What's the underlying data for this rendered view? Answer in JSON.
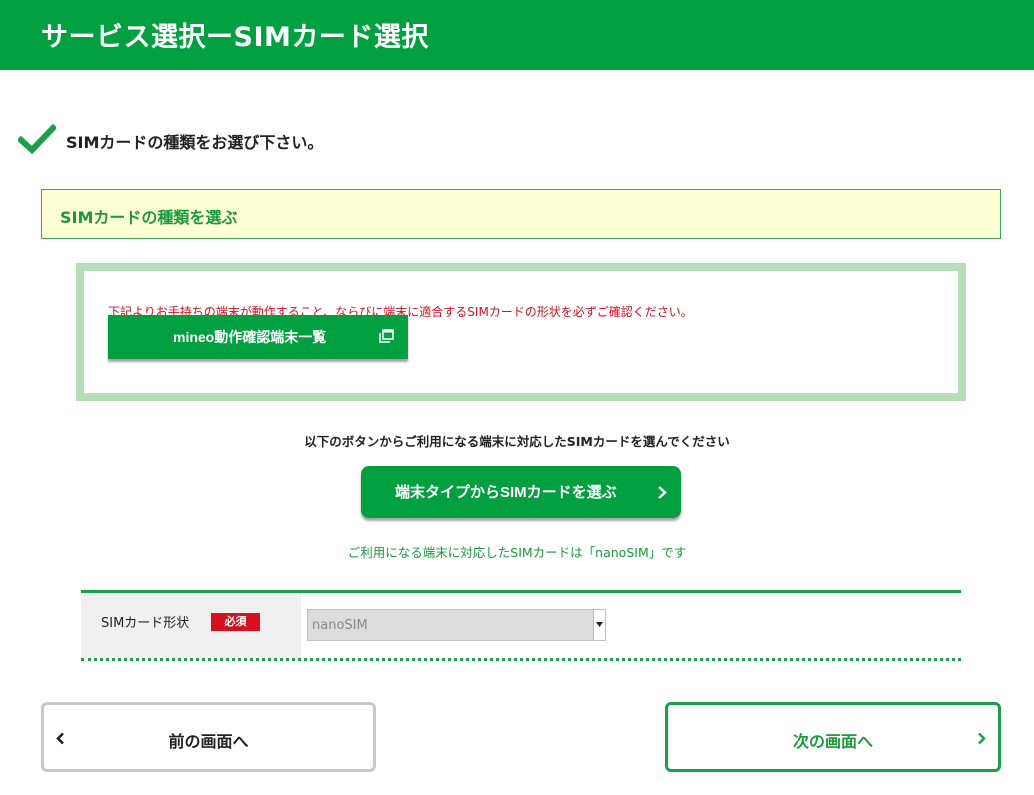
{
  "header": {
    "title": "サービス選択ーSIMカード選択"
  },
  "instruction": {
    "text": "SIMカードの種類をお選び下さい。"
  },
  "section": {
    "title": "SIMカードの種類を選ぶ"
  },
  "notice": {
    "text": "下記よりお手持ちの端末が動作すること、ならびに端末に適合するSIMカードの形状を必ずご確認ください。",
    "device_list_button": "mineo動作確認端末一覧"
  },
  "selection": {
    "guidance": "以下のボタンからご利用になる端末に対応したSIMカードを選んでください",
    "device_type_button": "端末タイプからSIMカードを選ぶ",
    "compat_note": "ご利用になる端末に対応したSIMカードは「nanoSIM」です"
  },
  "form": {
    "sim_shape_label": "SIMカード形状",
    "required_badge": "必須",
    "sim_shape_value": "nanoSIM"
  },
  "nav": {
    "prev_label": "前の画面へ",
    "next_label": "次の画面へ"
  },
  "colors": {
    "brand_green": "#00a040",
    "notice_red": "#d6101e",
    "section_bg": "#ffffd6",
    "notice_border": "#b5deb9"
  },
  "icons": [
    "check-icon",
    "new-window-icon",
    "chevron-right-icon",
    "chevron-left-icon",
    "select-arrow-icon"
  ]
}
